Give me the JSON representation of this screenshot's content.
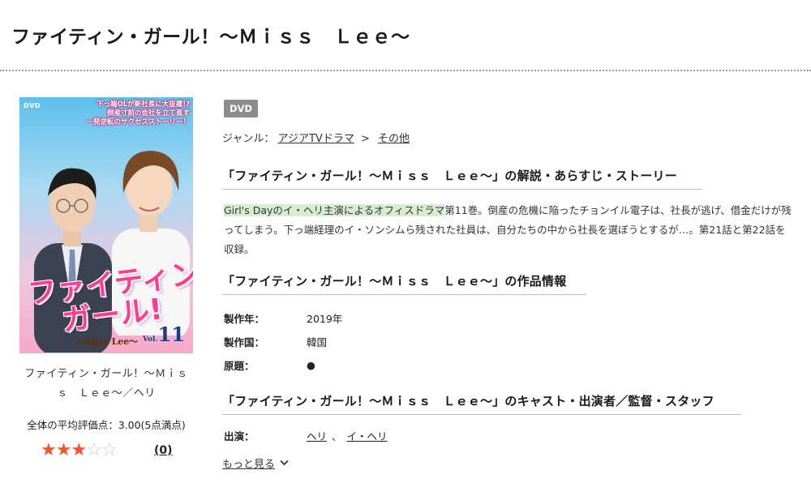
{
  "page": {
    "title": "ファイティン・ガール！〜Ｍｉｓｓ　Ｌｅｅ〜"
  },
  "cover": {
    "dvd_tag": "DVD",
    "tagline": [
      "下っ端OLが新社長に大抜擢!?",
      "倒産寸前の会社を立て直す",
      "一発逆転のサクセスストーリー！"
    ],
    "logo_line1": "ファイティン",
    "logo_line2": "ガール!",
    "subtitle": "〜Miss Lee〜",
    "vol_label": "Vol.",
    "vol_number": "11",
    "colors": {
      "bg_top": "#5cc0ec",
      "bg_bottom": "#f7a9c9",
      "logo": "#ff3d8e"
    }
  },
  "product": {
    "name_line1": "ファイティン・ガール！〜Ｍｉｓ",
    "name_line2": "ｓ　Ｌｅｅ〜／ヘリ",
    "avg_rating_text": "全体の平均評価点：3.00(5点満点)",
    "rating": 3,
    "rating_max": 5,
    "review_count": "(0)"
  },
  "badge": {
    "label": "DVD"
  },
  "genre": {
    "label": "ジャンル：",
    "items": [
      "アジアTVドラマ",
      "その他"
    ],
    "separator": ">"
  },
  "sections": {
    "synopsis_heading": "「ファイティン・ガール！〜Ｍｉｓｓ　Ｌｅｅ〜」の解説・あらすじ・ストーリー",
    "info_heading": "「ファイティン・ガール！〜Ｍｉｓｓ　Ｌｅｅ〜」の作品情報",
    "cast_heading": "「ファイティン・ガール！〜Ｍｉｓｓ　Ｌｅｅ〜」のキャスト・出演者／監督・スタッフ"
  },
  "synopsis": {
    "highlight": "Girl's Dayのイ・ヘリ主演によるオフィスドラマ",
    "rest": "第11巻。倒産の危機に陥ったチョンイル電子は、社長が逃げ、借金だけが残ってしまう。下っ端経理のイ・ソンシムら残された社員は、自分たちの中から社長を選ぼうとするが…。第21話と第22話を収録。"
  },
  "info": {
    "rows": [
      {
        "label": "製作年：",
        "value": "2019年"
      },
      {
        "label": "製作国：",
        "value": "韓国"
      },
      {
        "label": "原題：",
        "value": "●"
      }
    ]
  },
  "cast": {
    "label": "出演：",
    "items": [
      "ヘリ",
      "イ・ヘリ"
    ],
    "separator": "、"
  },
  "more": {
    "label": "もっと見る",
    "icon": "chevron-down-icon"
  }
}
